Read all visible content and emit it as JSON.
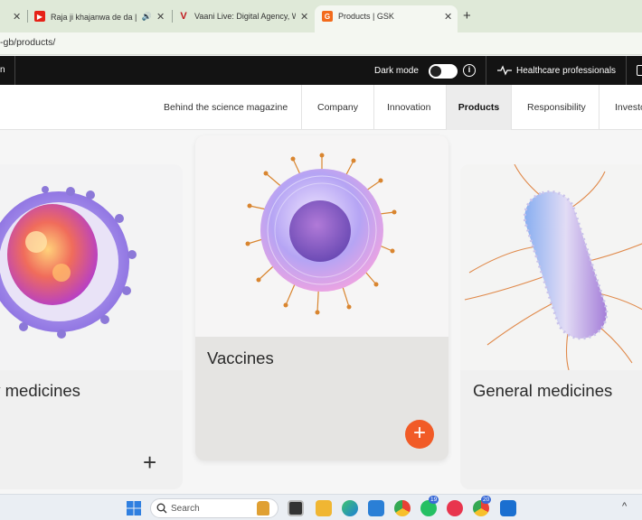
{
  "browser": {
    "tabs": [
      {
        "title": "",
        "close": "✕"
      },
      {
        "title": "Raja ji khajanwa de da | राज",
        "close": "✕",
        "audio": "🔊"
      },
      {
        "title": "Vaani Live: Digital Agency, Web",
        "close": "✕"
      },
      {
        "title": "Products | GSK",
        "close": "✕"
      }
    ],
    "new_tab": "+",
    "url": "-gb/products/"
  },
  "topbar": {
    "left_fragment": "n",
    "dark_mode_label": "Dark mode",
    "info_glyph": "i",
    "healthcare_label": "Healthcare professionals"
  },
  "nav": {
    "items": [
      {
        "label": "Behind the science magazine"
      },
      {
        "label": "Company"
      },
      {
        "label": "Innovation"
      },
      {
        "label": "Products",
        "active": true
      },
      {
        "label": "Responsibility"
      },
      {
        "label": "Investo"
      }
    ]
  },
  "cards": {
    "left": {
      "title": "cy medicines",
      "plus": "+"
    },
    "middle": {
      "title": "Vaccines",
      "plus": "+"
    },
    "right": {
      "title": "General medicines"
    }
  },
  "taskbar": {
    "search_label": "Search",
    "badges": [
      "19",
      "20"
    ],
    "caret": "^"
  },
  "colors": {
    "accent_orange": "#f15b27",
    "topbar_black": "#131313",
    "tabstrip_green": "#dfe9d8"
  }
}
